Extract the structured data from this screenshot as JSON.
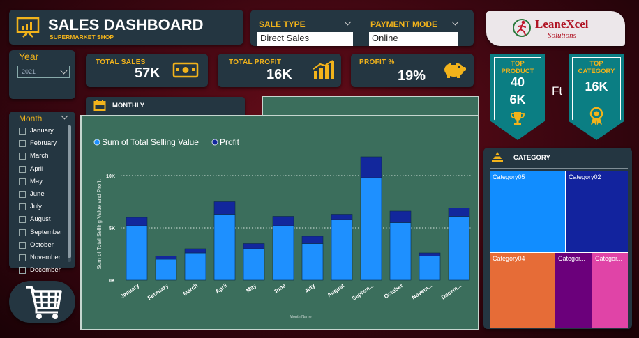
{
  "header": {
    "title": "SALES DASHBOARD",
    "subtitle": "SUPERMARKET SHOP"
  },
  "filters": {
    "sale_type_label": "SALE TYPE",
    "sale_type_value": "Direct Sales",
    "payment_mode_label": "PAYMENT MODE",
    "payment_mode_value": "Online",
    "year_label": "Year",
    "year_value": "2021"
  },
  "logo": {
    "brand": "LeaneXcel",
    "tagline": "Solutions"
  },
  "kpis": {
    "total_sales_label": "TOTAL SALES",
    "total_sales_value": "57K",
    "total_profit_label": "TOTAL PROFIT",
    "total_profit_value": "16K",
    "profit_pct_label": "PROFIT %",
    "profit_pct_value": "19%"
  },
  "top_product": {
    "line1": "TOP",
    "line2": "PRODUCT",
    "value1": "40",
    "value2": "6K"
  },
  "ft_label": "Ft",
  "top_category": {
    "line1": "TOP",
    "line2": "CATEGORY",
    "value": "16K"
  },
  "month_filter": {
    "label": "Month",
    "items": [
      "January",
      "February",
      "March",
      "April",
      "May",
      "June",
      "July",
      "August",
      "September",
      "October",
      "November",
      "December"
    ]
  },
  "monthly_tab": {
    "label": "MONTHLY"
  },
  "category_panel": {
    "title": "CATEGORY",
    "cells": [
      "Category05",
      "Category02",
      "Category04",
      "Categor...",
      "Categor..."
    ]
  },
  "colors": {
    "accent": "#f2b31b",
    "card": "#243641",
    "sales_bar": "#1e90ff",
    "profit_bar": "#12279c",
    "chart_bg": "#3b6e5c",
    "teal": "#0b7e83"
  },
  "chart_data": {
    "type": "bar",
    "stacked": true,
    "categories": [
      "January",
      "February",
      "March",
      "April",
      "May",
      "June",
      "July",
      "August",
      "September",
      "October",
      "November",
      "December"
    ],
    "tick_labels": [
      "January",
      "February",
      "March",
      "April",
      "May",
      "June",
      "July",
      "August",
      "Septem...",
      "October",
      "Novem...",
      "Decem..."
    ],
    "series": [
      {
        "name": "Sum of Total Selling Value",
        "values": [
          5200,
          2000,
          2600,
          6300,
          3000,
          5200,
          3500,
          5800,
          9800,
          5500,
          2300,
          6100
        ]
      },
      {
        "name": "Profit",
        "values": [
          800,
          300,
          400,
          1200,
          500,
          900,
          700,
          500,
          2000,
          1100,
          300,
          800
        ]
      }
    ],
    "ylabel": "Sum of Total Selling Value and Profit",
    "xlabel": "Month Name",
    "ylim": [
      0,
      12000
    ],
    "y_ticks": [
      {
        "v": 0,
        "label": "0K"
      },
      {
        "v": 5000,
        "label": "5K"
      },
      {
        "v": 10000,
        "label": "10K"
      }
    ],
    "grid": true,
    "legend_position": "top-left"
  }
}
